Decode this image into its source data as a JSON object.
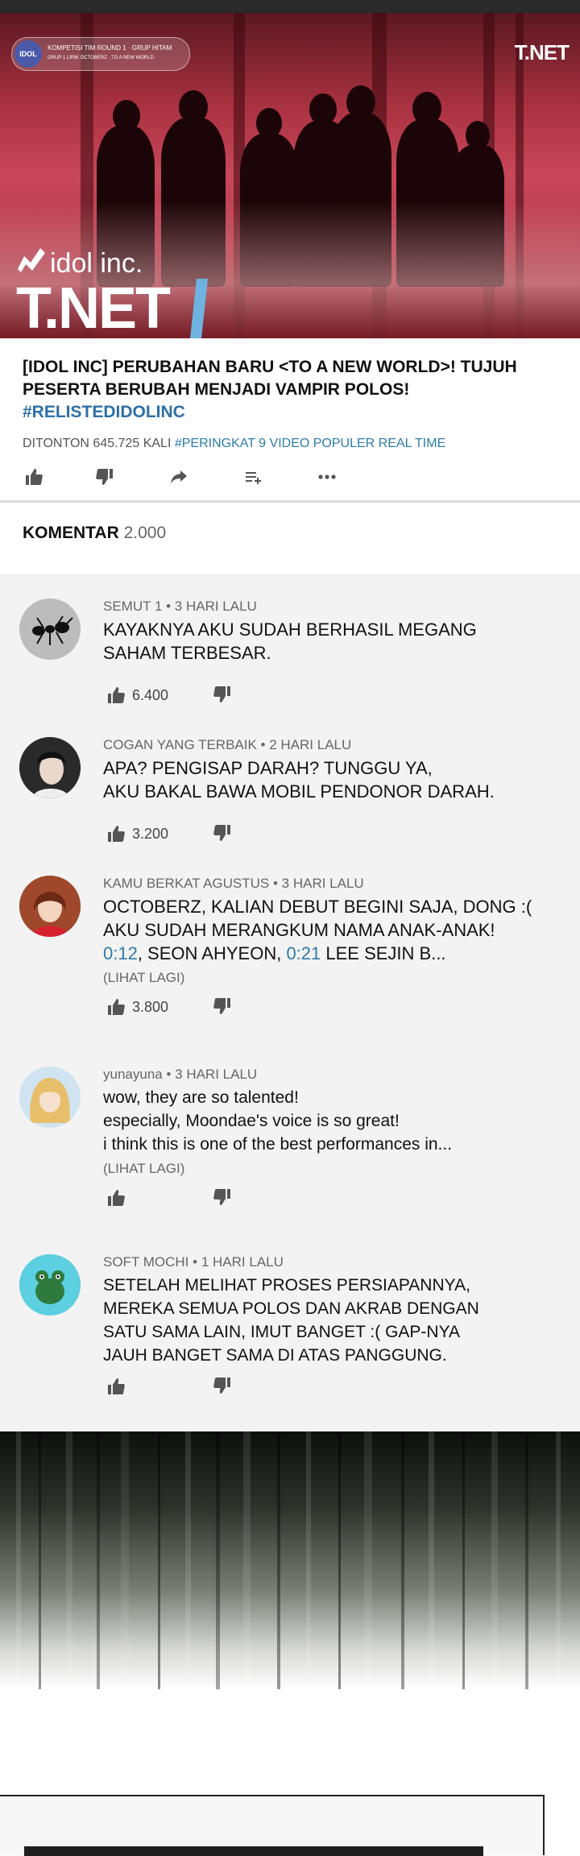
{
  "video": {
    "badge_number": "IDOL",
    "badge_line1": "KOMPETISI TIM ROUND 1 · GRUP HITAM",
    "badge_line2": "GRUP 1 LIRIK OCTOBERZ · TO A NEW WORLD",
    "corner_logo": "T.NET",
    "brand_sub": "idol inc.",
    "brand_main": "T.NET"
  },
  "title": {
    "line": "[IDOL INC] PERUBAHAN BARU <TO A NEW WORLD>! TUJUH PESERTA BERUBAH MENJADI VAMPIR POLOS!",
    "hashtag": "#RELISTEDIDOLINC"
  },
  "meta": {
    "views": "DITONTON 645.725 KALI",
    "ranking": "#PERINGKAT 9 VIDEO POPULER REAL TIME"
  },
  "actions": {
    "icons": [
      "like-icon",
      "dislike-icon",
      "share-icon",
      "add-to-playlist-icon",
      "more-icon"
    ]
  },
  "comments_header": {
    "label": "KOMENTAR",
    "count": "2.000"
  },
  "comments": [
    {
      "author": "SEMUT 1",
      "time": "3 HARI LALU",
      "text": [
        "KAYAKNYA AKU SUDAH BERHASIL MEGANG",
        "SAHAM TERBESAR."
      ],
      "likes": "6.400"
    },
    {
      "author": "COGAN YANG TERBAIK",
      "time": "2 HARI LALU",
      "text": [
        "APA? PENGISAP DARAH? TUNGGU YA,",
        "AKU BAKAL BAWA MOBIL PENDONOR DARAH."
      ],
      "likes": "3.200"
    },
    {
      "author": "KAMU BERKAT AGUSTUS",
      "time": "3 HARI LALU",
      "text": [
        "OCTOBERZ, KALIAN DEBUT BEGINI SAJA, DONG :(",
        "AKU SUDAH MERANGKUM NAMA ANAK-ANAK!"
      ],
      "text3": {
        "ts1": "0:12",
        "mid": ", SEON AHYEON, ",
        "ts2": "0:21",
        "end": " LEE SEJIN B..."
      },
      "more": "(LIHAT LAGI)",
      "likes": "3.800"
    },
    {
      "author": "yunayuna",
      "time": "3 HARI LALU",
      "text": [
        "wow, they are so talented!",
        "especially, Moondae's voice is so great!",
        "i think this is one of the best performances in..."
      ],
      "more": "(LIHAT LAGI)",
      "likes": ""
    },
    {
      "author": "SOFT MOCHI",
      "time": "1 HARI LALU",
      "text": [
        "SETELAH MELIHAT PROSES PERSIAPANNYA,",
        "MEREKA SEMUA POLOS DAN AKRAB DENGAN",
        "SATU SAMA LAIN, IMUT BANGET :( GAP-NYA",
        "JAUH BANGET SAMA DI ATAS PANGGUNG."
      ],
      "likes": ""
    }
  ],
  "colors": {
    "accent_link": "#2e7ca8",
    "hashtag": "#2e6fa5",
    "comment_bg": "#f3f3f3",
    "video_red": "#c9475a"
  }
}
